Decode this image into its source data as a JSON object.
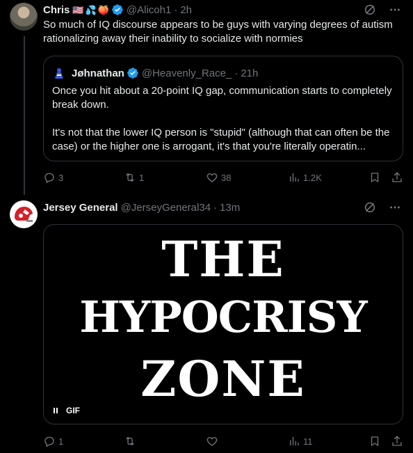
{
  "tweet1": {
    "name": "Chris",
    "emojis": [
      "🇺🇸",
      "💦",
      "🍑"
    ],
    "handle": "@Alicoh1",
    "time": "2h",
    "text": "So much of IQ discourse appears to be guys with varying degrees of autism rationalizing away their inability to socialize with normies",
    "quote": {
      "name": "Jøhnathan",
      "handle": "@Heavenly_Race_",
      "time": "21h",
      "text_line1": "Once you hit about a 20-point IQ gap, communication starts to completely break down.",
      "text_line2": "It's not that the lower IQ person is \"stupid\" (although that can often be the case) or the higher one is arrogant, it's that you're literally operatin..."
    },
    "actions": {
      "replies": "3",
      "reposts": "1",
      "likes": "38",
      "views": "1.2K"
    }
  },
  "tweet2": {
    "name": "Jersey General",
    "handle": "@JerseyGeneral34",
    "time": "13m",
    "gif": {
      "line1": "THE",
      "line2": "HYPOCRISY",
      "line3": "ZONE",
      "badge": "GIF"
    },
    "actions": {
      "replies": "1",
      "reposts": "",
      "likes": "",
      "views": "11"
    }
  },
  "separator": "·",
  "colors": {
    "accent": "#1d9bf0",
    "muted": "#71767b",
    "border": "#2f3336",
    "text": "#e7e9ea"
  }
}
